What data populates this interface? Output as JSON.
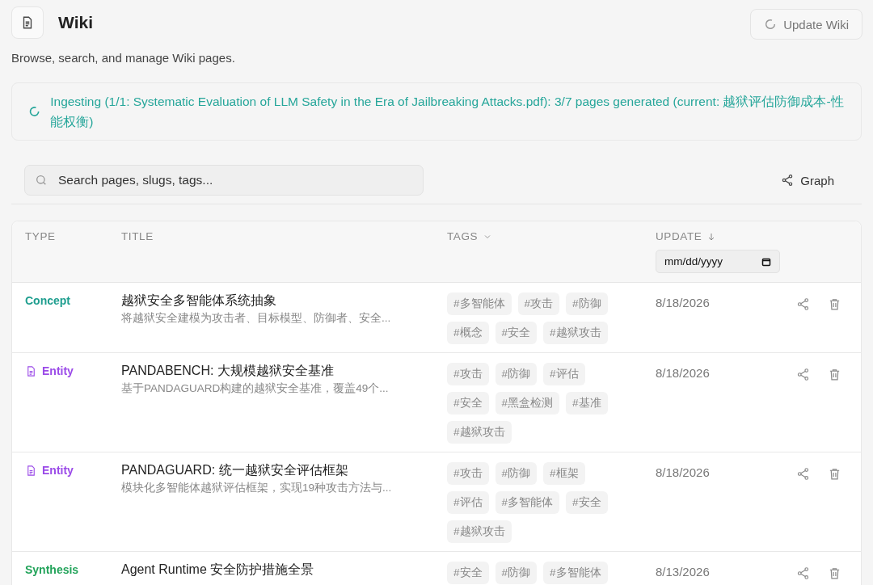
{
  "header": {
    "title": "Wiki",
    "subtitle": "Browse, search, and manage Wiki pages.",
    "update_button": "Update Wiki"
  },
  "banner": {
    "text": "Ingesting (1/1: Systematic Evaluation of LLM Safety in the Era of Jailbreaking Attacks.pdf): 3/7 pages generated (current: 越狱评估防御成本-性能权衡)"
  },
  "search": {
    "placeholder": "Search pages, slugs, tags..."
  },
  "graph_button": "Graph",
  "table": {
    "columns": [
      {
        "label": "TYPE",
        "kind": "plain"
      },
      {
        "label": "TITLE",
        "kind": "plain"
      },
      {
        "label": "TAGS",
        "kind": "filter"
      },
      {
        "label": "UPDATE",
        "kind": "sorted"
      }
    ],
    "date_filter": {
      "placeholder": "mm/dd/yyyy"
    },
    "rows": [
      {
        "type": {
          "label": "Concept",
          "kind": "concept"
        },
        "title": "越狱安全多智能体系统抽象",
        "summary": "将越狱安全建模为攻击者、目标模型、防御者、安全...",
        "tags": [
          "#多智能体",
          "#攻击",
          "#防御",
          "#概念",
          "#安全",
          "#越狱攻击"
        ],
        "updated": "8/18/2026"
      },
      {
        "type": {
          "label": "Entity",
          "kind": "entity"
        },
        "title": "PANDABENCH: 大规模越狱安全基准",
        "summary": "基于PANDAGUARD构建的越狱安全基准，覆盖49个...",
        "tags": [
          "#攻击",
          "#防御",
          "#评估",
          "#安全",
          "#黑盒检测",
          "#基准",
          "#越狱攻击"
        ],
        "updated": "8/18/2026"
      },
      {
        "type": {
          "label": "Entity",
          "kind": "entity"
        },
        "title": "PANDAGUARD: 统一越狱安全评估框架",
        "summary": "模块化多智能体越狱评估框架，实现19种攻击方法与...",
        "tags": [
          "#攻击",
          "#防御",
          "#框架",
          "#评估",
          "#多智能体",
          "#安全",
          "#越狱攻击"
        ],
        "updated": "8/18/2026"
      },
      {
        "type": {
          "label": "Synthesis",
          "kind": "synthesis"
        },
        "title": "Agent Runtime 安全防护措施全景",
        "tags": [
          "#安全",
          "#防御",
          "#多智能体"
        ],
        "updated": "8/13/2026"
      }
    ]
  }
}
